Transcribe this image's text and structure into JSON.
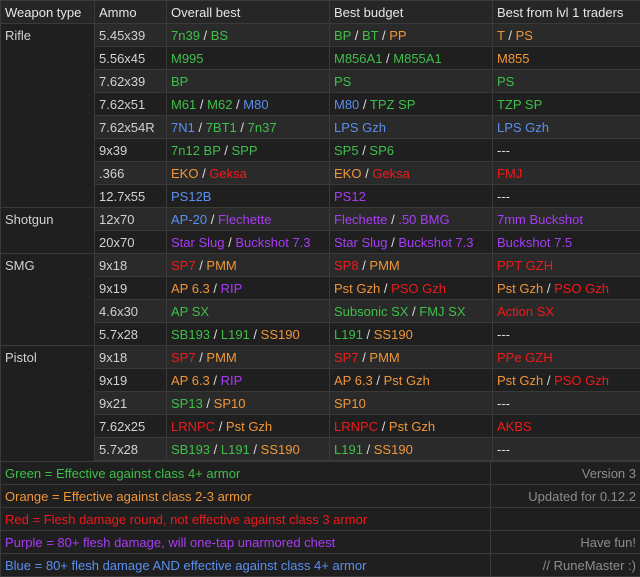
{
  "headers": [
    "Weapon type",
    "Ammo",
    "Overall best",
    "Best budget",
    "Best from lvl 1 traders"
  ],
  "rows": [
    {
      "type": "Rifle",
      "ammo": "5.45x39",
      "overall": [
        {
          "t": "7n39",
          "c": "g"
        },
        {
          "t": " / ",
          "c": "w"
        },
        {
          "t": "BS",
          "c": "g"
        }
      ],
      "budget": [
        {
          "t": "BP",
          "c": "g"
        },
        {
          "t": " / ",
          "c": "w"
        },
        {
          "t": "BT",
          "c": "g"
        },
        {
          "t": " / ",
          "c": "w"
        },
        {
          "t": "PP",
          "c": "o"
        }
      ],
      "lvl1": [
        {
          "t": "T",
          "c": "o"
        },
        {
          "t": " / ",
          "c": "w"
        },
        {
          "t": "PS",
          "c": "o"
        }
      ]
    },
    {
      "type": "",
      "ammo": "5.56x45",
      "overall": [
        {
          "t": "M995",
          "c": "g"
        }
      ],
      "budget": [
        {
          "t": "M856A1",
          "c": "g"
        },
        {
          "t": " / ",
          "c": "w"
        },
        {
          "t": "M855A1",
          "c": "g"
        }
      ],
      "lvl1": [
        {
          "t": "M855",
          "c": "o"
        }
      ]
    },
    {
      "type": "",
      "ammo": "7.62x39",
      "overall": [
        {
          "t": "BP",
          "c": "g"
        }
      ],
      "budget": [
        {
          "t": "PS",
          "c": "g"
        }
      ],
      "lvl1": [
        {
          "t": "PS",
          "c": "g"
        }
      ]
    },
    {
      "type": "",
      "ammo": "7.62x51",
      "overall": [
        {
          "t": "M61",
          "c": "g"
        },
        {
          "t": " / ",
          "c": "w"
        },
        {
          "t": "M62",
          "c": "g"
        },
        {
          "t": " / ",
          "c": "w"
        },
        {
          "t": "M80",
          "c": "b"
        }
      ],
      "budget": [
        {
          "t": "M80",
          "c": "b"
        },
        {
          "t": " / ",
          "c": "w"
        },
        {
          "t": "TPZ SP",
          "c": "g"
        }
      ],
      "lvl1": [
        {
          "t": "TZP SP",
          "c": "g"
        }
      ]
    },
    {
      "type": "",
      "ammo": "7.62x54R",
      "overall": [
        {
          "t": "7N1",
          "c": "b"
        },
        {
          "t": " / ",
          "c": "w"
        },
        {
          "t": "7BT1",
          "c": "g"
        },
        {
          "t": " / ",
          "c": "w"
        },
        {
          "t": "7n37",
          "c": "g"
        }
      ],
      "budget": [
        {
          "t": "LPS Gzh",
          "c": "b"
        }
      ],
      "lvl1": [
        {
          "t": "LPS Gzh",
          "c": "b"
        }
      ]
    },
    {
      "type": "",
      "ammo": "9x39",
      "overall": [
        {
          "t": "7n12 BP",
          "c": "g"
        },
        {
          "t": " / ",
          "c": "w"
        },
        {
          "t": "SPP",
          "c": "g"
        }
      ],
      "budget": [
        {
          "t": "SP5",
          "c": "g"
        },
        {
          "t": " / ",
          "c": "w"
        },
        {
          "t": "SP6",
          "c": "g"
        }
      ],
      "lvl1": [
        {
          "t": "---",
          "c": "w"
        }
      ]
    },
    {
      "type": "",
      "ammo": ".366",
      "overall": [
        {
          "t": "EKO",
          "c": "o"
        },
        {
          "t": " / ",
          "c": "w"
        },
        {
          "t": "Geksa",
          "c": "r"
        }
      ],
      "budget": [
        {
          "t": "EKO",
          "c": "o"
        },
        {
          "t": " / ",
          "c": "w"
        },
        {
          "t": "Geksa",
          "c": "r"
        }
      ],
      "lvl1": [
        {
          "t": "FMJ",
          "c": "r"
        }
      ]
    },
    {
      "type": "",
      "ammo": "12.7x55",
      "overall": [
        {
          "t": "PS12B",
          "c": "b"
        }
      ],
      "budget": [
        {
          "t": "PS12",
          "c": "p"
        }
      ],
      "lvl1": [
        {
          "t": "---",
          "c": "w"
        }
      ]
    },
    {
      "type": "Shotgun",
      "ammo": "12x70",
      "overall": [
        {
          "t": "AP-20",
          "c": "b"
        },
        {
          "t": " / ",
          "c": "w"
        },
        {
          "t": "Flechette",
          "c": "p"
        }
      ],
      "budget": [
        {
          "t": "Flechette",
          "c": "p"
        },
        {
          "t": " / ",
          "c": "w"
        },
        {
          "t": ".50 BMG",
          "c": "p"
        }
      ],
      "lvl1": [
        {
          "t": "7mm Buckshot",
          "c": "p"
        }
      ]
    },
    {
      "type": "",
      "ammo": "20x70",
      "overall": [
        {
          "t": "Star Slug",
          "c": "p"
        },
        {
          "t": " / ",
          "c": "w"
        },
        {
          "t": "Buckshot 7.3",
          "c": "p"
        }
      ],
      "budget": [
        {
          "t": "Star Slug",
          "c": "p"
        },
        {
          "t": " / ",
          "c": "w"
        },
        {
          "t": "Buckshot 7.3",
          "c": "p"
        }
      ],
      "lvl1": [
        {
          "t": "Buckshot 7.5",
          "c": "p"
        }
      ]
    },
    {
      "type": "SMG",
      "ammo": "9x18",
      "overall": [
        {
          "t": "SP7",
          "c": "r"
        },
        {
          "t": " / ",
          "c": "w"
        },
        {
          "t": "PMM",
          "c": "o"
        }
      ],
      "budget": [
        {
          "t": "SP8",
          "c": "r"
        },
        {
          "t": " / ",
          "c": "w"
        },
        {
          "t": "PMM",
          "c": "o"
        }
      ],
      "lvl1": [
        {
          "t": "PPT GZH",
          "c": "r"
        }
      ]
    },
    {
      "type": "",
      "ammo": "9x19",
      "overall": [
        {
          "t": "AP 6.3",
          "c": "o"
        },
        {
          "t": " / ",
          "c": "w"
        },
        {
          "t": "RIP",
          "c": "p"
        }
      ],
      "budget": [
        {
          "t": "Pst Gzh",
          "c": "o"
        },
        {
          "t": " / ",
          "c": "w"
        },
        {
          "t": "PSO Gzh",
          "c": "r"
        }
      ],
      "lvl1": [
        {
          "t": "Pst Gzh",
          "c": "o"
        },
        {
          "t": " / ",
          "c": "w"
        },
        {
          "t": "PSO Gzh",
          "c": "r"
        }
      ]
    },
    {
      "type": "",
      "ammo": "4.6x30",
      "overall": [
        {
          "t": "AP SX",
          "c": "g"
        }
      ],
      "budget": [
        {
          "t": "Subsonic SX",
          "c": "g"
        },
        {
          "t": " / ",
          "c": "w"
        },
        {
          "t": "FMJ SX",
          "c": "g"
        }
      ],
      "lvl1": [
        {
          "t": "Action SX",
          "c": "r"
        }
      ]
    },
    {
      "type": "",
      "ammo": "5.7x28",
      "overall": [
        {
          "t": "SB193",
          "c": "g"
        },
        {
          "t": " / ",
          "c": "w"
        },
        {
          "t": "L191",
          "c": "g"
        },
        {
          "t": " / ",
          "c": "w"
        },
        {
          "t": "SS190",
          "c": "o"
        }
      ],
      "budget": [
        {
          "t": "L191",
          "c": "g"
        },
        {
          "t": " / ",
          "c": "w"
        },
        {
          "t": "SS190",
          "c": "o"
        }
      ],
      "lvl1": [
        {
          "t": "---",
          "c": "w"
        }
      ]
    },
    {
      "type": "Pistol",
      "ammo": "9x18",
      "overall": [
        {
          "t": "SP7",
          "c": "r"
        },
        {
          "t": " / ",
          "c": "w"
        },
        {
          "t": "PMM",
          "c": "o"
        }
      ],
      "budget": [
        {
          "t": "SP7",
          "c": "r"
        },
        {
          "t": " / ",
          "c": "w"
        },
        {
          "t": "PMM",
          "c": "o"
        }
      ],
      "lvl1": [
        {
          "t": "PPe GZH",
          "c": "r"
        }
      ]
    },
    {
      "type": "",
      "ammo": "9x19",
      "overall": [
        {
          "t": "AP 6.3",
          "c": "o"
        },
        {
          "t": " / ",
          "c": "w"
        },
        {
          "t": "RIP",
          "c": "p"
        }
      ],
      "budget": [
        {
          "t": "AP 6.3",
          "c": "o"
        },
        {
          "t": " / ",
          "c": "w"
        },
        {
          "t": "Pst Gzh",
          "c": "o"
        }
      ],
      "lvl1": [
        {
          "t": "Pst Gzh",
          "c": "o"
        },
        {
          "t": " / ",
          "c": "w"
        },
        {
          "t": "PSO Gzh",
          "c": "r"
        }
      ]
    },
    {
      "type": "",
      "ammo": "9x21",
      "overall": [
        {
          "t": "SP13",
          "c": "g"
        },
        {
          "t": " / ",
          "c": "w"
        },
        {
          "t": "SP10",
          "c": "o"
        }
      ],
      "budget": [
        {
          "t": "SP10",
          "c": "o"
        }
      ],
      "lvl1": [
        {
          "t": "---",
          "c": "w"
        }
      ]
    },
    {
      "type": "",
      "ammo": "7.62x25",
      "overall": [
        {
          "t": "LRNPC",
          "c": "r"
        },
        {
          "t": " / ",
          "c": "w"
        },
        {
          "t": "Pst Gzh",
          "c": "o"
        }
      ],
      "budget": [
        {
          "t": "LRNPC",
          "c": "r"
        },
        {
          "t": " / ",
          "c": "w"
        },
        {
          "t": "Pst Gzh",
          "c": "o"
        }
      ],
      "lvl1": [
        {
          "t": "AKBS",
          "c": "r"
        }
      ]
    },
    {
      "type": "",
      "ammo": "5.7x28",
      "overall": [
        {
          "t": "SB193",
          "c": "g"
        },
        {
          "t": " / ",
          "c": "w"
        },
        {
          "t": "L191",
          "c": "g"
        },
        {
          "t": " / ",
          "c": "w"
        },
        {
          "t": "SS190",
          "c": "o"
        }
      ],
      "budget": [
        {
          "t": "L191",
          "c": "g"
        },
        {
          "t": " / ",
          "c": "w"
        },
        {
          "t": "SS190",
          "c": "o"
        }
      ],
      "lvl1": [
        {
          "t": "---",
          "c": "w"
        }
      ]
    }
  ],
  "legend": [
    {
      "text": "Green = Effective against class 4+ armor",
      "c": "g",
      "right": "Version 3"
    },
    {
      "text": "Orange = Effective against class 2-3 armor",
      "c": "o",
      "right": "Updated for 0.12.2"
    },
    {
      "text": "Red = Flesh damage round, not effective against class 3 armor",
      "c": "r",
      "right": ""
    },
    {
      "text": "Purple = 80+ flesh damage, will one-tap unarmored chest",
      "c": "p",
      "right": "Have fun!"
    },
    {
      "text": "Blue = 80+ flesh damage AND effective against class 4+ armor",
      "c": "b",
      "right": "// RuneMaster :)"
    }
  ],
  "colors": {
    "g": "#3fbf4a",
    "o": "#f0963a",
    "r": "#f01a1a",
    "p": "#a83cf5",
    "b": "#5b8fef",
    "w": "#dcdcdc"
  }
}
